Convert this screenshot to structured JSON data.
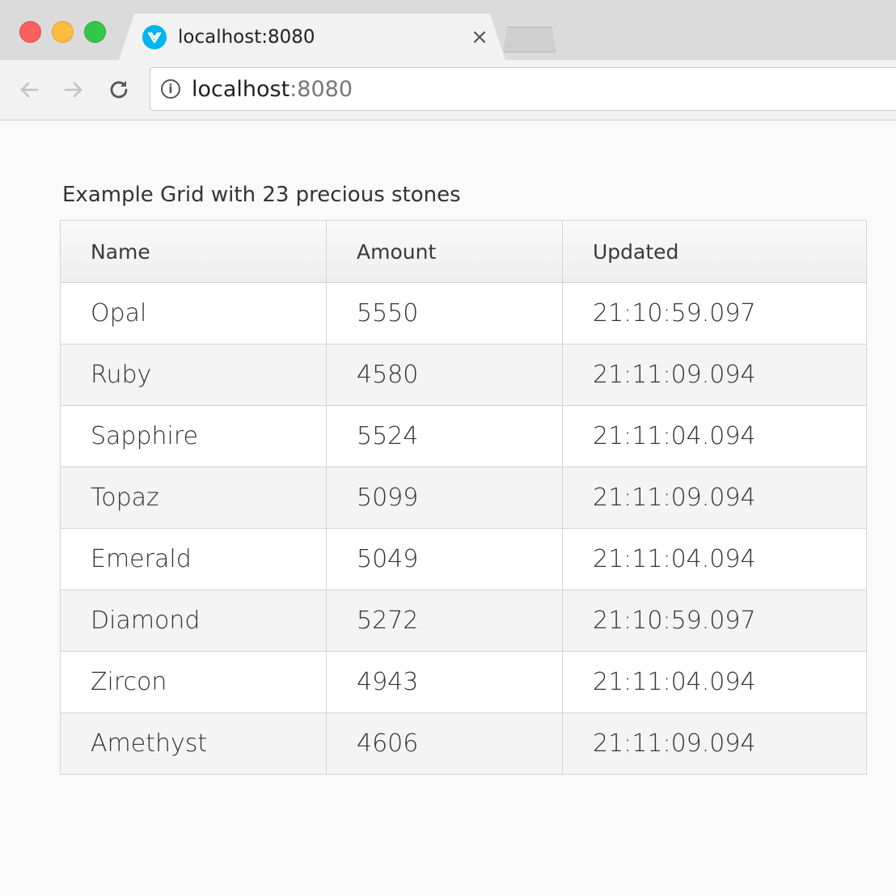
{
  "browser": {
    "tab_title": "localhost:8080",
    "tab_close": "×",
    "url_host": "localhost",
    "url_port": ":8080",
    "icons": {
      "back": "arrow-left",
      "forward": "arrow-right",
      "reload": "reload",
      "info": "info",
      "favicon": "vaadin-logo"
    }
  },
  "grid": {
    "caption": "Example Grid with 23 precious stones",
    "columns": [
      "Name",
      "Amount",
      "Updated"
    ],
    "rows": [
      [
        "Opal",
        "5550",
        "21:10:59.097"
      ],
      [
        "Ruby",
        "4580",
        "21:11:09.094"
      ],
      [
        "Sapphire",
        "5524",
        "21:11:04.094"
      ],
      [
        "Topaz",
        "5099",
        "21:11:09.094"
      ],
      [
        "Emerald",
        "5049",
        "21:11:04.094"
      ],
      [
        "Diamond",
        "5272",
        "21:10:59.097"
      ],
      [
        "Zircon",
        "4943",
        "21:11:04.094"
      ],
      [
        "Amethyst",
        "4606",
        "21:11:09.094"
      ]
    ]
  },
  "colors": {
    "favicon": "#00b4f0",
    "traffic_close": "#fc605c",
    "traffic_min": "#fdbc40",
    "traffic_max": "#34c84a"
  }
}
